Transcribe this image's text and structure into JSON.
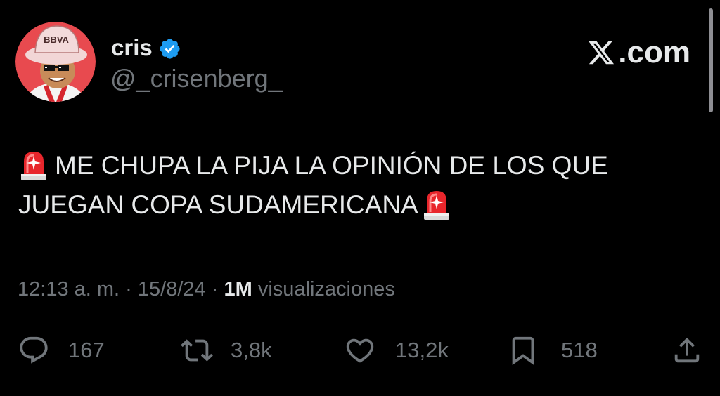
{
  "author": {
    "display_name": "cris",
    "handle": "@_crisenberg_",
    "avatar_hat_text": "BBVA",
    "verified_color": "#1d9bf0"
  },
  "brand": {
    "text": ".com",
    "icon": "x-logo-icon"
  },
  "tweet": {
    "line1": "ME CHUPA LA PIJA LA OPINIÓN DE LOS QUE",
    "line2": "JUEGAN COPA SUDAMERICANA",
    "emoji": "police-car-light-icon"
  },
  "meta": {
    "time": "12:13 a. m.",
    "separator": "·",
    "date": "15/8/24",
    "views_count": "1M",
    "views_label": "visualizaciones"
  },
  "actions": {
    "replies": "167",
    "reposts": "3,8k",
    "likes": "13,2k",
    "bookmarks": "518"
  },
  "colors": {
    "background": "#000000",
    "text": "#e7e9ea",
    "secondary": "#71767b",
    "verified": "#1d9bf0"
  }
}
